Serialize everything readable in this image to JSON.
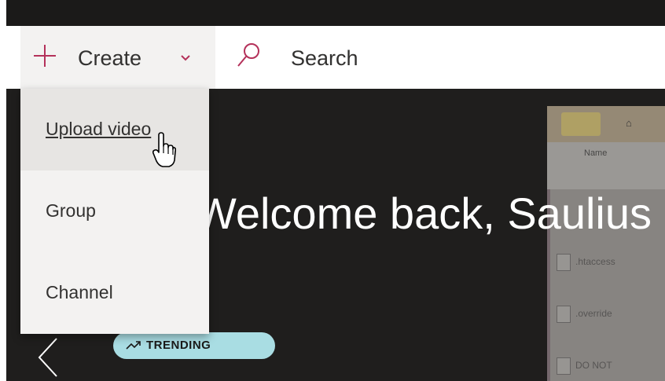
{
  "header": {
    "create_label": "Create",
    "search_label": "Search"
  },
  "create_menu": {
    "items": [
      {
        "label": "Upload video"
      },
      {
        "label": "Group"
      },
      {
        "label": "Channel"
      }
    ]
  },
  "hero": {
    "welcome_text": "Welcome back, Saulius",
    "trending_label": "TRENDING"
  },
  "thumbnail": {
    "column_header": "Name",
    "files": [
      ".htaccess",
      ".override",
      "DO NOT"
    ]
  },
  "icons": {
    "plus": "plus-icon",
    "chevron": "chevron-down-icon",
    "search": "search-icon",
    "prev": "chevron-left-icon",
    "trending": "trending-icon",
    "cursor": "hand-pointer-icon"
  },
  "colors": {
    "accent": "#b4315a",
    "trending_badge": "#a9dde3",
    "topbar": "#1b1a19"
  }
}
